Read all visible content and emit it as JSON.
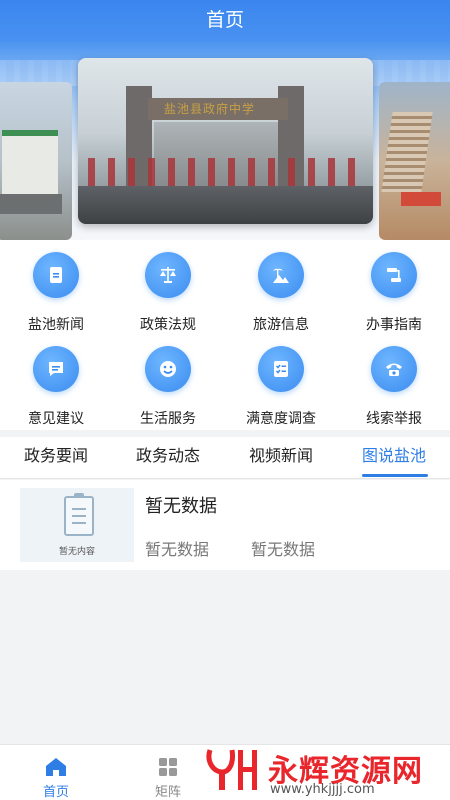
{
  "header": {
    "title": "首页"
  },
  "banner": {
    "gate_sign": "盐池县政府中学"
  },
  "services": [
    {
      "label": "盐池新闻",
      "icon": "document-icon"
    },
    {
      "label": "政策法规",
      "icon": "scales-icon"
    },
    {
      "label": "旅游信息",
      "icon": "palm-mountain-icon"
    },
    {
      "label": "办事指南",
      "icon": "flowchart-icon"
    },
    {
      "label": "意见建议",
      "icon": "chat-bubble-icon"
    },
    {
      "label": "生活服务",
      "icon": "smiley-icon"
    },
    {
      "label": "满意度调查",
      "icon": "checklist-icon"
    },
    {
      "label": "线索举报",
      "icon": "phone-icon"
    }
  ],
  "tabs": [
    {
      "label": "政务要闻"
    },
    {
      "label": "政务动态"
    },
    {
      "label": "视频新闻"
    },
    {
      "label": "图说盐池",
      "active": true
    }
  ],
  "list": {
    "thumb_caption": "暂无内容",
    "title": "暂无数据",
    "meta1": "暂无数据",
    "meta2": "暂无数据"
  },
  "bottom_nav": [
    {
      "label": "首页",
      "icon": "home-icon",
      "active": true
    },
    {
      "label": "矩阵",
      "icon": "grid-icon"
    }
  ],
  "watermark": {
    "text": "永辉资源网",
    "url": "www.yhkjjjj.com"
  },
  "colors": {
    "accent": "#2f7ee6",
    "header": "#3a86ee",
    "watermark_red": "#e8262c"
  }
}
